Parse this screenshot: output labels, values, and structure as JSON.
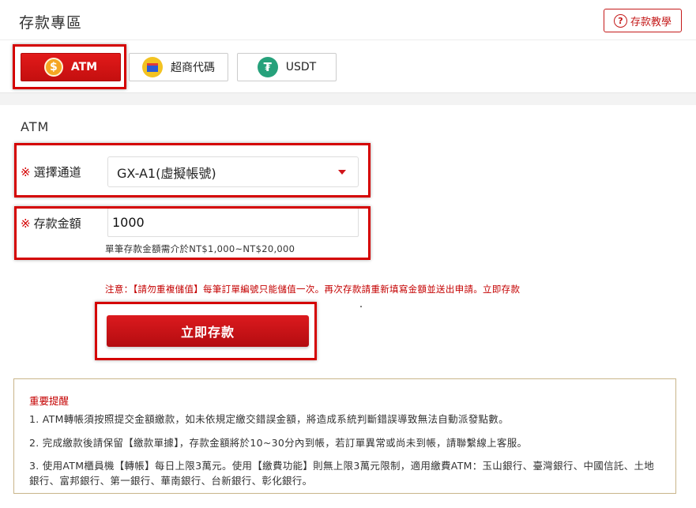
{
  "header": {
    "title": "存款專區",
    "tutorial_button": "存款教學",
    "tutorial_icon": "?"
  },
  "tabs": [
    {
      "label": "ATM",
      "icon": "dollar-coin-icon",
      "active": true
    },
    {
      "label": "超商代碼",
      "icon": "convenience-store-icon",
      "active": false
    },
    {
      "label": "USDT",
      "icon": "tether-icon",
      "active": false
    }
  ],
  "form": {
    "section_title": "ATM",
    "required_mark": "※",
    "channel_label": "選擇通道",
    "channel_value": "GX-A1(虛擬帳號)",
    "amount_label": "存款金額",
    "amount_value": "1000",
    "amount_hint": "單筆存款金額需介於NT$1,000~NT$20,000",
    "notice": "注意：【請勿重複儲值】每筆訂單編號只能儲值一次。再次存款請重新填寫金額並送出申請。立即存款",
    "submit_label": "立即存款"
  },
  "notes": {
    "title": "重要提醒",
    "items": [
      "1. ATM轉帳須按照提交金額繳款，如未依規定繳交錯誤金額，將造成系統判斷錯誤導致無法自動派發點數。",
      "2. 完成繳款後請保留【繳款單據】，存款金額將於10~30分內到帳，若訂單異常或尚未到帳，請聯繫線上客服。",
      "3. 使用ATM櫃員機【轉帳】每日上限3萬元。使用【繳費功能】則無上限3萬元限制，適用繳費ATM：玉山銀行、臺灣銀行、中國信託、土地銀行、富邦銀行、第一銀行、華南銀行、台新銀行、彰化銀行。"
    ]
  },
  "colors": {
    "accent_red": "#d40000",
    "tab_active": "#d8181a",
    "notes_border": "#c9b58a"
  }
}
